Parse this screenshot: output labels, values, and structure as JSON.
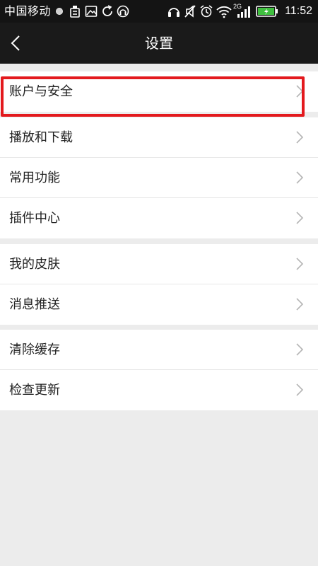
{
  "status_bar": {
    "carrier": "中国移动",
    "time": "11:52",
    "network_label": "2G",
    "icons": [
      "notification-dot-icon",
      "clean-icon",
      "image-icon",
      "sync-icon",
      "music-icon",
      "headphones-icon",
      "mute-icon",
      "alarm-icon",
      "wifi-icon",
      "signal-icon",
      "battery-charging-icon"
    ]
  },
  "header": {
    "title": "设置",
    "back_icon": "back-arrow-icon"
  },
  "groups": [
    {
      "items": [
        {
          "label": "账户与安全"
        }
      ]
    },
    {
      "items": [
        {
          "label": "播放和下载"
        },
        {
          "label": "常用功能"
        },
        {
          "label": "插件中心"
        }
      ]
    },
    {
      "items": [
        {
          "label": "我的皮肤"
        },
        {
          "label": "消息推送"
        }
      ]
    },
    {
      "items": [
        {
          "label": "清除缓存"
        },
        {
          "label": "检查更新"
        }
      ]
    }
  ],
  "colors": {
    "status_bar_bg": "#141414",
    "title_bar_bg": "#1a1a1a",
    "page_bg": "#ececec",
    "row_bg": "#ffffff",
    "highlight": "#e3191d",
    "battery": "#3fbf3f"
  }
}
